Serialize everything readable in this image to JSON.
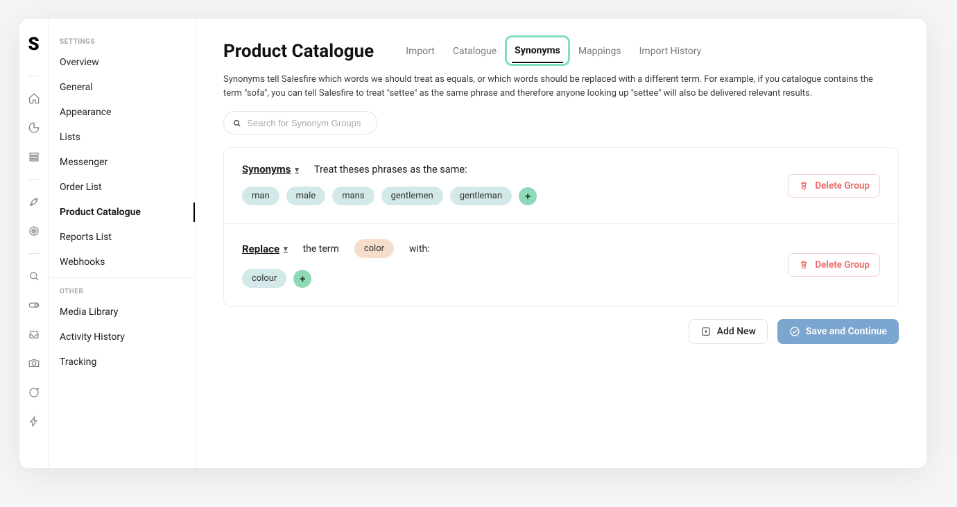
{
  "logo_letter": "S",
  "sidebar": {
    "sections": [
      {
        "title": "SETTINGS",
        "items": [
          "Overview",
          "General",
          "Appearance",
          "Lists",
          "Messenger",
          "Order List",
          "Product Catalogue",
          "Reports List",
          "Webhooks"
        ],
        "active": "Product Catalogue"
      },
      {
        "title": "OTHER",
        "items": [
          "Media Library",
          "Activity History",
          "Tracking"
        ],
        "active": null
      }
    ]
  },
  "page": {
    "title": "Product Catalogue",
    "tabs": [
      "Import",
      "Catalogue",
      "Synonyms",
      "Mappings",
      "Import History"
    ],
    "active_tab": "Synonyms",
    "description": "Synonyms tell Salesfire which words we should treat as equals, or which words should be replaced with a different term. For example, if you catalogue contains the term \"sofa\", you can tell Salesfire to treat \"settee\" as the same phrase and therefore anyone looking up \"settee\" will also be delivered relevant results.",
    "search_placeholder": "Search for Synonym Groups"
  },
  "groups": [
    {
      "type_label": "Synonyms",
      "desc": "Treat theses phrases as the same:",
      "header_inline": null,
      "terms": [
        "man",
        "male",
        "mans",
        "gentlemen",
        "gentleman"
      ]
    },
    {
      "type_label": "Replace",
      "desc": null,
      "header_inline": {
        "pre": "the term",
        "term": "color",
        "post": "with:"
      },
      "terms": [
        "colour"
      ]
    }
  ],
  "buttons": {
    "delete_group": "Delete Group",
    "add_new": "Add New",
    "save_continue": "Save and Continue",
    "plus": "+"
  }
}
